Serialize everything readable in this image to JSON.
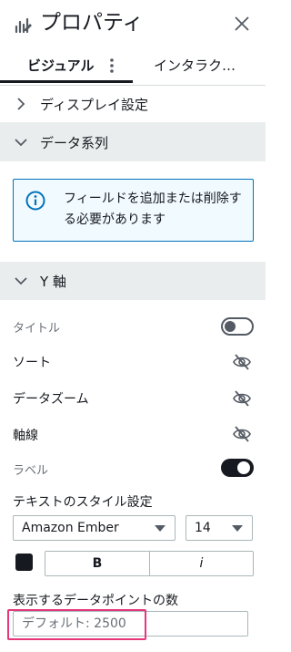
{
  "header": {
    "title": "プロパティ",
    "icon": "properties-icon",
    "close_icon": "close-icon"
  },
  "tabs": [
    {
      "label": "ビジュアル",
      "active": true
    },
    {
      "label": "インタラク…",
      "active": false
    }
  ],
  "sections": {
    "display": {
      "label": "ディスプレイ設定",
      "expanded": false
    },
    "data_series": {
      "label": "データ系列",
      "expanded": true
    },
    "y_axis": {
      "label": "Y 軸",
      "expanded": true
    }
  },
  "info": {
    "text": "フィールドを追加または削除する必要があります",
    "icon": "info-icon"
  },
  "y_axis": {
    "title_label": "タイトル",
    "title_toggle": false,
    "sort_label": "ソート",
    "zoom_label": "データズーム",
    "axis_line_label": "軸線",
    "labels_label": "ラベル",
    "labels_toggle": true,
    "text_style_label": "テキストのスタイル設定",
    "font_family": "Amazon Ember",
    "font_size": "14",
    "font_color": "#16191f",
    "bold_label": "B",
    "italic_label": "i",
    "points_label": "表示するデータポイントの数",
    "points_placeholder": "デフォルト: 2500"
  },
  "colors": {
    "accent": "#0073bb",
    "highlight": "#e8367a",
    "section_bg": "#eaeded"
  }
}
